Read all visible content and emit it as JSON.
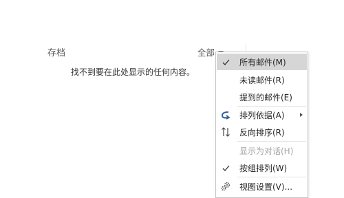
{
  "folder": {
    "title": "存档",
    "empty_message": "找不到要在此处显示的任何内容。"
  },
  "filter": {
    "label": "全部"
  },
  "menu": {
    "items": [
      {
        "label": "所有邮件(M)",
        "icon": "checkmark-icon",
        "checked": true,
        "highlighted": true
      },
      {
        "label": "未读邮件(R)"
      },
      {
        "label": "提到的邮件(E)"
      },
      {
        "label": "排列依据(A)",
        "icon": "arrange-by-icon",
        "has_submenu": true
      },
      {
        "label": "反向排序(R)",
        "icon": "reverse-sort-icon"
      },
      {
        "label": "显示为对话(H)",
        "disabled": true
      },
      {
        "label": "按组排列(W)",
        "icon": "checkmark-icon",
        "checked": true
      },
      {
        "label": "视图设置(V)...",
        "icon": "view-settings-icon"
      }
    ]
  },
  "colors": {
    "highlight": "#d6d6d6",
    "arrange_icon": "#2e5f9e",
    "disabled_text": "#a6a6a6"
  }
}
